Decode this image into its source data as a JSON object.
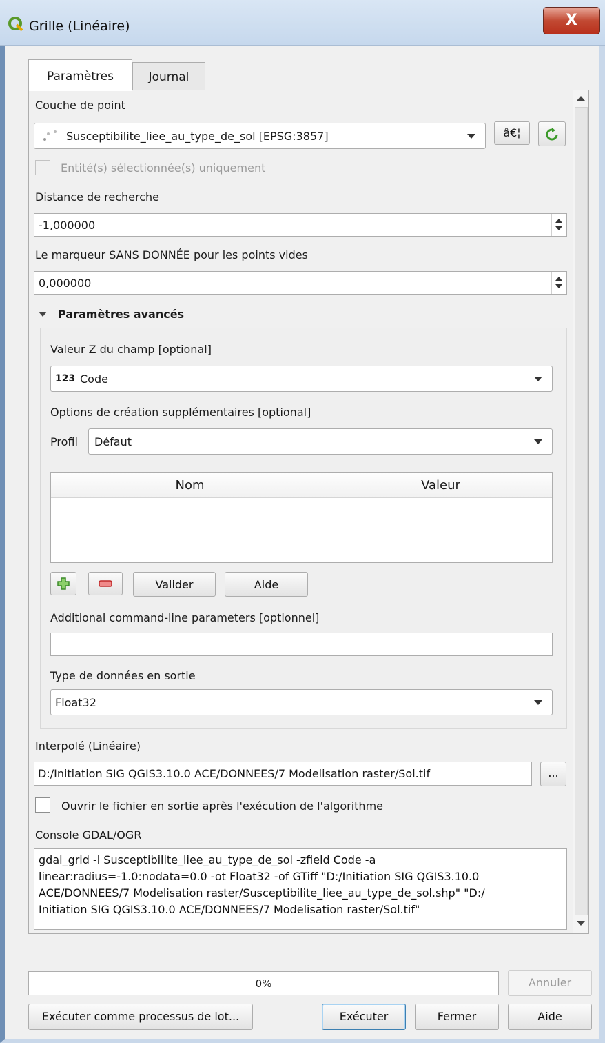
{
  "window": {
    "title": "Grille (Linéaire)",
    "close_glyph": "X"
  },
  "tabs": [
    {
      "label": "Paramètres",
      "active": true
    },
    {
      "label": "Journal",
      "active": false
    }
  ],
  "params": {
    "point_layer": {
      "label": "Couche de point",
      "value": "Susceptibilite_liee_au_type_de_sol [EPSG:3857]",
      "ellipsis_button": "â€¦",
      "selected_only_label": "Entité(s) sélectionnée(s) uniquement"
    },
    "search_distance": {
      "label": "Distance de recherche",
      "value": "-1,000000"
    },
    "nodata": {
      "label": "Le marqueur SANS DONNÉE pour les points vides",
      "value": "0,000000"
    },
    "advanced": {
      "header": "Paramètres avancés",
      "z_field": {
        "label": "Valeur Z du champ [optional]",
        "type_badge": "123",
        "value": "Code"
      },
      "creation_options": {
        "label": "Options de création supplémentaires [optional]",
        "profile_label": "Profil",
        "profile_value": "Défaut",
        "columns": [
          "Nom",
          "Valeur"
        ],
        "validate_button": "Valider",
        "help_button": "Aide"
      },
      "additional_params": {
        "label": "Additional command-line parameters [optionnel]",
        "value": ""
      },
      "output_type": {
        "label": "Type de données en sortie",
        "value": "Float32"
      }
    },
    "output": {
      "label": "Interpolé (Linéaire)",
      "value": "D:/Initiation SIG QGIS3.10.0 ACE/DONNEES/7 Modelisation raster/Sol.tif",
      "browse_button": "...",
      "open_after_label": "Ouvrir le fichier en sortie après l'exécution de l'algorithme"
    },
    "console": {
      "label": "Console GDAL/OGR",
      "lines": [
        "gdal_grid -l Susceptibilite_liee_au_type_de_sol -zfield Code -a",
        "linear:radius=-1.0:nodata=0.0 -ot Float32 -of GTiff \"D:/Initiation SIG QGIS3.10.0",
        "ACE/DONNEES/7 Modelisation raster/Susceptibilite_liee_au_type_de_sol.shp\" \"D:/",
        "Initiation SIG QGIS3.10.0 ACE/DONNEES/7 Modelisation raster/Sol.tif\""
      ]
    }
  },
  "footer": {
    "progress_text": "0%",
    "progress_value": 0,
    "cancel_button": "Annuler",
    "batch_button": "Exécuter comme processus de lot...",
    "run_button": "Exécuter",
    "close_button": "Fermer",
    "help_button": "Aide"
  },
  "colors": {
    "qgis_green": "#5a9a2a",
    "title_bar": "#cfdff0",
    "close_red": "#c24a33"
  }
}
